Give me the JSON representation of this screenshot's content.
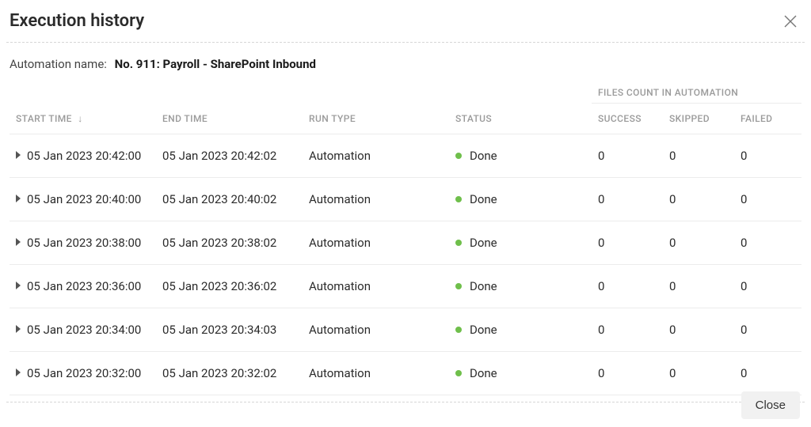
{
  "title": "Execution history",
  "automation_name_label": "Automation name:",
  "automation_name_value": "No. 911: Payroll - SharePoint Inbound",
  "group_header": "FILES COUNT IN AUTOMATION",
  "columns": {
    "start_time": "START TIME",
    "end_time": "END TIME",
    "run_type": "RUN TYPE",
    "status": "STATUS",
    "success": "SUCCESS",
    "skipped": "SKIPPED",
    "failed": "FAILED"
  },
  "sort_indicator": "↓",
  "rows": [
    {
      "start": "05 Jan 2023 20:42:00",
      "end": "05 Jan 2023 20:42:02",
      "run_type": "Automation",
      "status": "Done",
      "success": "0",
      "skipped": "0",
      "failed": "0"
    },
    {
      "start": "05 Jan 2023 20:40:00",
      "end": "05 Jan 2023 20:40:02",
      "run_type": "Automation",
      "status": "Done",
      "success": "0",
      "skipped": "0",
      "failed": "0"
    },
    {
      "start": "05 Jan 2023 20:38:00",
      "end": "05 Jan 2023 20:38:02",
      "run_type": "Automation",
      "status": "Done",
      "success": "0",
      "skipped": "0",
      "failed": "0"
    },
    {
      "start": "05 Jan 2023 20:36:00",
      "end": "05 Jan 2023 20:36:02",
      "run_type": "Automation",
      "status": "Done",
      "success": "0",
      "skipped": "0",
      "failed": "0"
    },
    {
      "start": "05 Jan 2023 20:34:00",
      "end": "05 Jan 2023 20:34:03",
      "run_type": "Automation",
      "status": "Done",
      "success": "0",
      "skipped": "0",
      "failed": "0"
    },
    {
      "start": "05 Jan 2023 20:32:00",
      "end": "05 Jan 2023 20:32:02",
      "run_type": "Automation",
      "status": "Done",
      "success": "0",
      "skipped": "0",
      "failed": "0"
    }
  ],
  "close_button": "Close"
}
